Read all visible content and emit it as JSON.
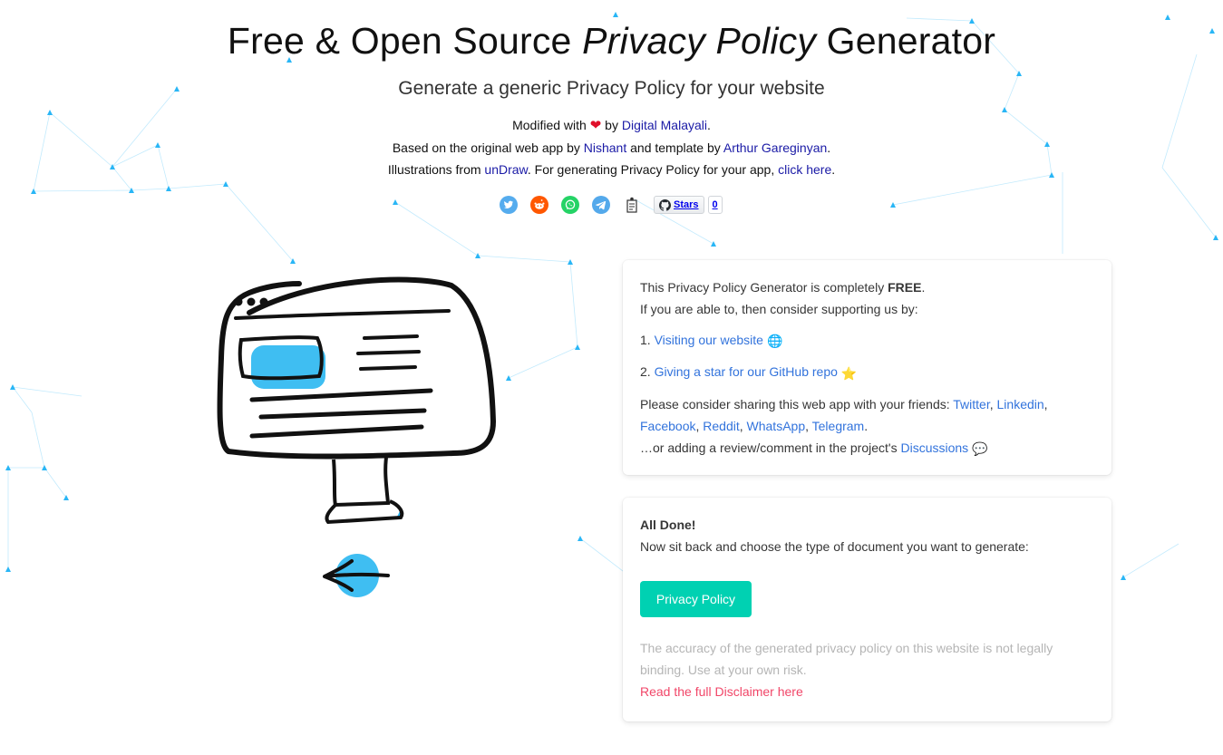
{
  "header": {
    "title_pre": "Free & Open Source ",
    "title_em": "Privacy Policy",
    "title_post": " Generator",
    "subtitle": "Generate a generic Privacy Policy for your website",
    "modified_pre": "Modified with ",
    "modified_by": " by ",
    "modified_link": "Digital Malayali",
    "modified_post": ".",
    "based_pre": "Based on the original web app by ",
    "based_link1": "Nishant",
    "based_mid": " and template by ",
    "based_link2": "Arthur Gareginyan",
    "based_post": ".",
    "illus_pre": "Illustrations from ",
    "illus_link": "unDraw",
    "illus_mid": ". For generating Privacy Policy for your app, ",
    "illus_link2": "click here",
    "illus_post": "."
  },
  "share": {
    "icons": [
      "twitter-icon",
      "reddit-icon",
      "whatsapp-icon",
      "telegram-icon",
      "producthunt-icon"
    ],
    "github_label": "Stars",
    "github_count": "0",
    "colors": {
      "twitter": "#55acee",
      "reddit": "#ff5700",
      "whatsapp": "#25d366",
      "telegram": "#54a9eb"
    }
  },
  "support_card": {
    "line1_pre": "This Privacy Policy Generator is completely ",
    "line1_bold": "FREE",
    "line1_post": ".",
    "line2": "If you are able to, then consider supporting us by:",
    "item1_num": "1.",
    "item1_link": "Visiting our website",
    "item1_emoji": "🌐",
    "item2_num": "2.",
    "item2_link": "Giving a star for our GitHub repo",
    "item2_emoji": "⭐",
    "share_pre": "Please consider sharing this web app with your friends: ",
    "share_links": [
      "Twitter",
      "Linkedin",
      "Facebook",
      "Reddit",
      "WhatsApp",
      "Telegram"
    ],
    "share_post": ".",
    "review_pre": "…or adding a review/comment in the project's ",
    "review_link": "Discussions",
    "review_emoji": "💬"
  },
  "done_card": {
    "title": "All Done!",
    "text": "Now sit back and choose the type of document you want to generate:",
    "button": "Privacy Policy",
    "disclaimer": "The accuracy of the generated privacy policy on this website is not legally binding. Use at your own risk.",
    "disclaimer_link": "Read the full Disclaimer here"
  },
  "colors": {
    "primary_button": "#00d1b2",
    "link": "#3273dc",
    "danger_link": "#f14668",
    "credit_link": "#1a1aa6",
    "network": "#29b6f6"
  }
}
